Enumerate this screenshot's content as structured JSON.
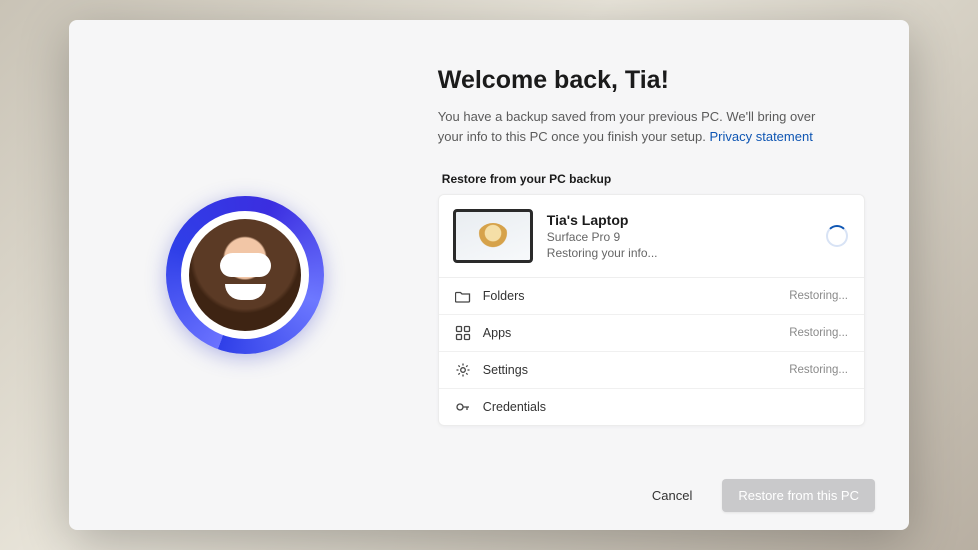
{
  "header": {
    "title": "Welcome back, Tia!",
    "subtitle_pre": "You have a backup saved from your previous PC. We'll bring over your info to this PC once you finish your setup. ",
    "privacy_link": "Privacy statement"
  },
  "restore": {
    "section_label": "Restore from your PC backup",
    "device": {
      "name": "Tia's Laptop",
      "model": "Surface Pro 9",
      "status": "Restoring your info..."
    },
    "items": [
      {
        "icon": "folder-icon",
        "label": "Folders",
        "status": "Restoring..."
      },
      {
        "icon": "apps-icon",
        "label": "Apps",
        "status": "Restoring..."
      },
      {
        "icon": "settings-icon",
        "label": "Settings",
        "status": "Restoring..."
      },
      {
        "icon": "key-icon",
        "label": "Credentials",
        "status": ""
      }
    ]
  },
  "footer": {
    "cancel": "Cancel",
    "primary": "Restore from this PC"
  }
}
